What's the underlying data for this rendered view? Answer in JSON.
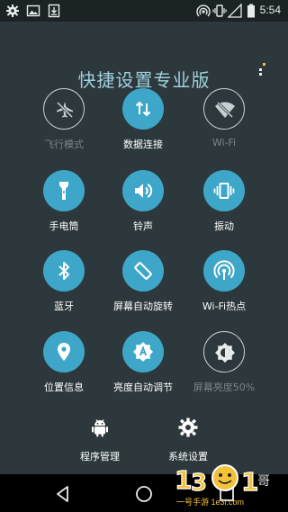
{
  "status_bar": {
    "time": "5:54",
    "left_icons": [
      "settings-gear-icon",
      "image-icon",
      "download-icon"
    ],
    "right_icons": [
      "hotspot-icon",
      "vibrate-icon",
      "signal-icon",
      "battery-icon"
    ]
  },
  "app": {
    "title": "快捷设置专业版"
  },
  "tiles": [
    {
      "name": "airplane-mode",
      "label": "飞行模式",
      "active": false,
      "icon": "airplane-off-icon"
    },
    {
      "name": "data-connection",
      "label": "数据连接",
      "active": true,
      "icon": "data-arrows-icon"
    },
    {
      "name": "wifi",
      "label": "Wi-Fi",
      "active": false,
      "icon": "wifi-off-icon"
    },
    {
      "name": "flashlight",
      "label": "手电筒",
      "active": true,
      "icon": "flashlight-icon"
    },
    {
      "name": "ringtone",
      "label": "铃声",
      "active": true,
      "icon": "volume-icon"
    },
    {
      "name": "vibrate",
      "label": "振动",
      "active": true,
      "icon": "vibrate-icon"
    },
    {
      "name": "bluetooth",
      "label": "蓝牙",
      "active": true,
      "icon": "bluetooth-icon"
    },
    {
      "name": "auto-rotate",
      "label": "屏幕自动旋转",
      "active": true,
      "icon": "screen-rotation-icon"
    },
    {
      "name": "wifi-hotspot",
      "label": "Wi-Fi热点",
      "active": true,
      "icon": "hotspot-icon"
    },
    {
      "name": "location",
      "label": "位置信息",
      "active": true,
      "icon": "location-pin-icon"
    },
    {
      "name": "auto-brightness",
      "label": "亮度自动调节",
      "active": true,
      "icon": "brightness-auto-icon"
    },
    {
      "name": "screen-brightness",
      "label": "屏幕亮度50%",
      "active": false,
      "icon": "brightness-half-icon"
    }
  ],
  "bottom": {
    "app_manager_label": "程序管理",
    "system_settings_label": "系统设置"
  },
  "nav_bar": {
    "buttons": [
      "back-icon",
      "home-icon",
      "recents-icon"
    ]
  },
  "watermark": {
    "text": "一号手游  1e3i.com"
  },
  "colors": {
    "accent": "#3ea7c9",
    "panel": "#2c383b",
    "title": "#9fd0df",
    "inactive_label": "#7a8588"
  }
}
